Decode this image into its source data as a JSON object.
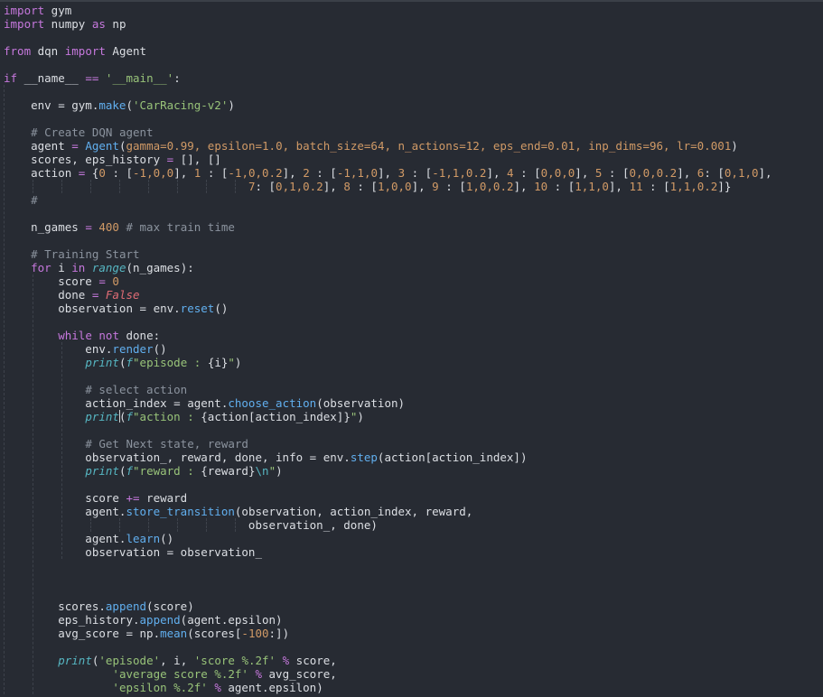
{
  "colors": {
    "background": "#272b33",
    "keyword": "#c678dd",
    "plain": "#dcdfe4",
    "string": "#98c379",
    "number": "#d19a66",
    "function": "#61afef",
    "builtin": "#56b6c2",
    "comment": "#8b939e",
    "constant": "#e06c75",
    "params": "#d19a66"
  },
  "code_lines": [
    {
      "row": 0,
      "tokens": [
        [
          "kw",
          "import"
        ],
        [
          "p",
          " gym"
        ]
      ]
    },
    {
      "row": 1,
      "tokens": [
        [
          "kw",
          "import"
        ],
        [
          "p",
          " numpy "
        ],
        [
          "kw",
          "as"
        ],
        [
          "p",
          " np"
        ]
      ]
    },
    {
      "row": 3,
      "tokens": [
        [
          "kw",
          "from"
        ],
        [
          "p",
          " dqn "
        ],
        [
          "kw",
          "import"
        ],
        [
          "p",
          " Agent"
        ]
      ]
    },
    {
      "row": 5,
      "tokens": [
        [
          "kw",
          "if"
        ],
        [
          "p",
          " __name__ "
        ],
        [
          "kw",
          "=="
        ],
        [
          "p",
          " "
        ],
        [
          "str",
          "'__main__'"
        ],
        [
          "p",
          ":"
        ]
      ]
    },
    {
      "row": 7,
      "tokens": [
        [
          "p",
          "    env = gym."
        ],
        [
          "fn",
          "make"
        ],
        [
          "p",
          "("
        ],
        [
          "str",
          "'CarRacing-v2'"
        ],
        [
          "p",
          ")"
        ]
      ]
    },
    {
      "row": 9,
      "tokens": [
        [
          "p",
          "    "
        ],
        [
          "cm",
          "# Create DQN agent"
        ]
      ]
    },
    {
      "row": 10,
      "tokens": [
        [
          "p",
          "    agent "
        ],
        [
          "kw",
          "="
        ],
        [
          "p",
          " "
        ],
        [
          "fn",
          "Agent"
        ],
        [
          "p",
          "("
        ],
        [
          "prm",
          "gamma=0.99, epsilon=1.0, batch_size=64, n_actions=12, eps_end=0.01, inp_dims=96, lr=0.001"
        ],
        [
          "p",
          ")"
        ]
      ]
    },
    {
      "row": 11,
      "tokens": [
        [
          "p",
          "    scores, eps_history "
        ],
        [
          "kw",
          "="
        ],
        [
          "p",
          " [], []"
        ]
      ]
    },
    {
      "row": 12,
      "tokens": [
        [
          "p",
          "    action "
        ],
        [
          "kw",
          "="
        ],
        [
          "p",
          " {"
        ],
        [
          "num",
          "0"
        ],
        [
          "p",
          " : ["
        ],
        [
          "num",
          "-1,0,0"
        ],
        [
          "p",
          "], "
        ],
        [
          "num",
          "1"
        ],
        [
          "p",
          " : ["
        ],
        [
          "num",
          "-1,0,0.2"
        ],
        [
          "p",
          "], "
        ],
        [
          "num",
          "2"
        ],
        [
          "p",
          " : ["
        ],
        [
          "num",
          "-1,1,0"
        ],
        [
          "p",
          "], "
        ],
        [
          "num",
          "3"
        ],
        [
          "p",
          " : ["
        ],
        [
          "num",
          "-1,1,0.2"
        ],
        [
          "p",
          "], "
        ],
        [
          "num",
          "4"
        ],
        [
          "p",
          " : ["
        ],
        [
          "num",
          "0,0,0"
        ],
        [
          "p",
          "], "
        ],
        [
          "num",
          "5"
        ],
        [
          "p",
          " : ["
        ],
        [
          "num",
          "0,0,0.2"
        ],
        [
          "p",
          "], "
        ],
        [
          "num",
          "6"
        ],
        [
          "p",
          ": ["
        ],
        [
          "num",
          "0,1,0"
        ],
        [
          "p",
          "],"
        ]
      ]
    },
    {
      "row": 13,
      "tokens": [
        [
          "p",
          "                                    "
        ],
        [
          "num",
          "7"
        ],
        [
          "p",
          ": ["
        ],
        [
          "num",
          "0,1,0.2"
        ],
        [
          "p",
          "], "
        ],
        [
          "num",
          "8"
        ],
        [
          "p",
          " : ["
        ],
        [
          "num",
          "1,0,0"
        ],
        [
          "p",
          "], "
        ],
        [
          "num",
          "9"
        ],
        [
          "p",
          " : ["
        ],
        [
          "num",
          "1,0,0.2"
        ],
        [
          "p",
          "], "
        ],
        [
          "num",
          "10"
        ],
        [
          "p",
          " : ["
        ],
        [
          "num",
          "1,1,0"
        ],
        [
          "p",
          "], "
        ],
        [
          "num",
          "11"
        ],
        [
          "p",
          " : ["
        ],
        [
          "num",
          "1,1,0.2"
        ],
        [
          "p",
          "]}"
        ]
      ]
    },
    {
      "row": 14,
      "tokens": [
        [
          "p",
          "    "
        ],
        [
          "cm",
          "#"
        ]
      ]
    },
    {
      "row": 16,
      "tokens": [
        [
          "p",
          "    n_games "
        ],
        [
          "kw",
          "="
        ],
        [
          "p",
          " "
        ],
        [
          "num",
          "400"
        ],
        [
          "p",
          " "
        ],
        [
          "cm",
          "# max train time"
        ]
      ]
    },
    {
      "row": 18,
      "tokens": [
        [
          "p",
          "    "
        ],
        [
          "cm",
          "# Training Start"
        ]
      ]
    },
    {
      "row": 19,
      "tokens": [
        [
          "p",
          "    "
        ],
        [
          "kw",
          "for"
        ],
        [
          "p",
          " i "
        ],
        [
          "kw",
          "in"
        ],
        [
          "p",
          " "
        ],
        [
          "bi",
          "range"
        ],
        [
          "p",
          "(n_games):"
        ]
      ]
    },
    {
      "row": 20,
      "tokens": [
        [
          "p",
          "        score "
        ],
        [
          "kw",
          "="
        ],
        [
          "p",
          " "
        ],
        [
          "num",
          "0"
        ]
      ]
    },
    {
      "row": 21,
      "tokens": [
        [
          "p",
          "        done "
        ],
        [
          "kw",
          "="
        ],
        [
          "p",
          " "
        ],
        [
          "cst",
          "False"
        ]
      ]
    },
    {
      "row": 22,
      "tokens": [
        [
          "p",
          "        observation = env."
        ],
        [
          "fn",
          "reset"
        ],
        [
          "p",
          "()"
        ]
      ]
    },
    {
      "row": 24,
      "tokens": [
        [
          "p",
          "        "
        ],
        [
          "kw",
          "while"
        ],
        [
          "p",
          " "
        ],
        [
          "kw",
          "not"
        ],
        [
          "p",
          " done:"
        ]
      ]
    },
    {
      "row": 25,
      "tokens": [
        [
          "p",
          "            env."
        ],
        [
          "fn",
          "render"
        ],
        [
          "p",
          "()"
        ]
      ]
    },
    {
      "row": 26,
      "tokens": [
        [
          "p",
          "            "
        ],
        [
          "bi",
          "print"
        ],
        [
          "p",
          "("
        ],
        [
          "bi",
          "f"
        ],
        [
          "str",
          "\"episode : "
        ],
        [
          "p",
          "{i}"
        ],
        [
          "str",
          "\""
        ],
        [
          "p",
          ")"
        ]
      ]
    },
    {
      "row": 28,
      "tokens": [
        [
          "p",
          "            "
        ],
        [
          "cm",
          "# select action"
        ]
      ]
    },
    {
      "row": 29,
      "tokens": [
        [
          "p",
          "            action_index = agent."
        ],
        [
          "fn",
          "choose_action"
        ],
        [
          "p",
          "(observation)"
        ]
      ]
    },
    {
      "row": 30,
      "tokens": [
        [
          "p",
          "            "
        ],
        [
          "bi",
          "print"
        ],
        [
          "p",
          "("
        ],
        [
          "bi",
          "f"
        ],
        [
          "str",
          "\"action : "
        ],
        [
          "p",
          "{action[action_index]}"
        ],
        [
          "str",
          "\""
        ],
        [
          "p",
          ")"
        ]
      ]
    },
    {
      "row": 32,
      "tokens": [
        [
          "p",
          "            "
        ],
        [
          "cm",
          "# Get Next state, reward"
        ]
      ]
    },
    {
      "row": 33,
      "tokens": [
        [
          "p",
          "            observation_, reward, done, info = env."
        ],
        [
          "fn",
          "step"
        ],
        [
          "p",
          "(action[action_index])"
        ]
      ]
    },
    {
      "row": 34,
      "tokens": [
        [
          "p",
          "            "
        ],
        [
          "bi",
          "print"
        ],
        [
          "p",
          "("
        ],
        [
          "bi",
          "f"
        ],
        [
          "str",
          "\"reward : "
        ],
        [
          "p",
          "{reward}"
        ],
        [
          "bi",
          "\\n"
        ],
        [
          "str",
          "\""
        ],
        [
          "p",
          ")"
        ]
      ]
    },
    {
      "row": 36,
      "tokens": [
        [
          "p",
          "            score "
        ],
        [
          "kw",
          "+="
        ],
        [
          "p",
          " reward"
        ]
      ]
    },
    {
      "row": 37,
      "tokens": [
        [
          "p",
          "            agent."
        ],
        [
          "fn",
          "store_transition"
        ],
        [
          "p",
          "(observation, action_index, reward,"
        ]
      ]
    },
    {
      "row": 38,
      "tokens": [
        [
          "p",
          "                                    observation_, done)"
        ]
      ]
    },
    {
      "row": 39,
      "tokens": [
        [
          "p",
          "            agent."
        ],
        [
          "fn",
          "learn"
        ],
        [
          "p",
          "()"
        ]
      ]
    },
    {
      "row": 40,
      "tokens": [
        [
          "p",
          "            observation = observation_"
        ]
      ]
    },
    {
      "row": 44,
      "tokens": [
        [
          "p",
          "        scores."
        ],
        [
          "fn",
          "append"
        ],
        [
          "p",
          "(score)"
        ]
      ]
    },
    {
      "row": 45,
      "tokens": [
        [
          "p",
          "        eps_history."
        ],
        [
          "fn",
          "append"
        ],
        [
          "p",
          "(agent.epsilon)"
        ]
      ]
    },
    {
      "row": 46,
      "tokens": [
        [
          "p",
          "        avg_score = np."
        ],
        [
          "fn",
          "mean"
        ],
        [
          "p",
          "(scores["
        ],
        [
          "num",
          "-100"
        ],
        [
          "p",
          ":])"
        ]
      ]
    },
    {
      "row": 48,
      "tokens": [
        [
          "p",
          "        "
        ],
        [
          "bi",
          "print"
        ],
        [
          "p",
          "("
        ],
        [
          "str",
          "'episode'"
        ],
        [
          "p",
          ", i, "
        ],
        [
          "str",
          "'score %.2f'"
        ],
        [
          "p",
          " "
        ],
        [
          "kw",
          "%"
        ],
        [
          "p",
          " score,"
        ]
      ]
    },
    {
      "row": 49,
      "tokens": [
        [
          "p",
          "                "
        ],
        [
          "str",
          "'average score %.2f'"
        ],
        [
          "p",
          " "
        ],
        [
          "kw",
          "%"
        ],
        [
          "p",
          " avg_score,"
        ]
      ]
    },
    {
      "row": 50,
      "tokens": [
        [
          "p",
          "                "
        ],
        [
          "str",
          "'epsilon %.2f'"
        ],
        [
          "p",
          " "
        ],
        [
          "kw",
          "%"
        ],
        [
          "p",
          " agent.epsilon)"
        ]
      ]
    }
  ]
}
